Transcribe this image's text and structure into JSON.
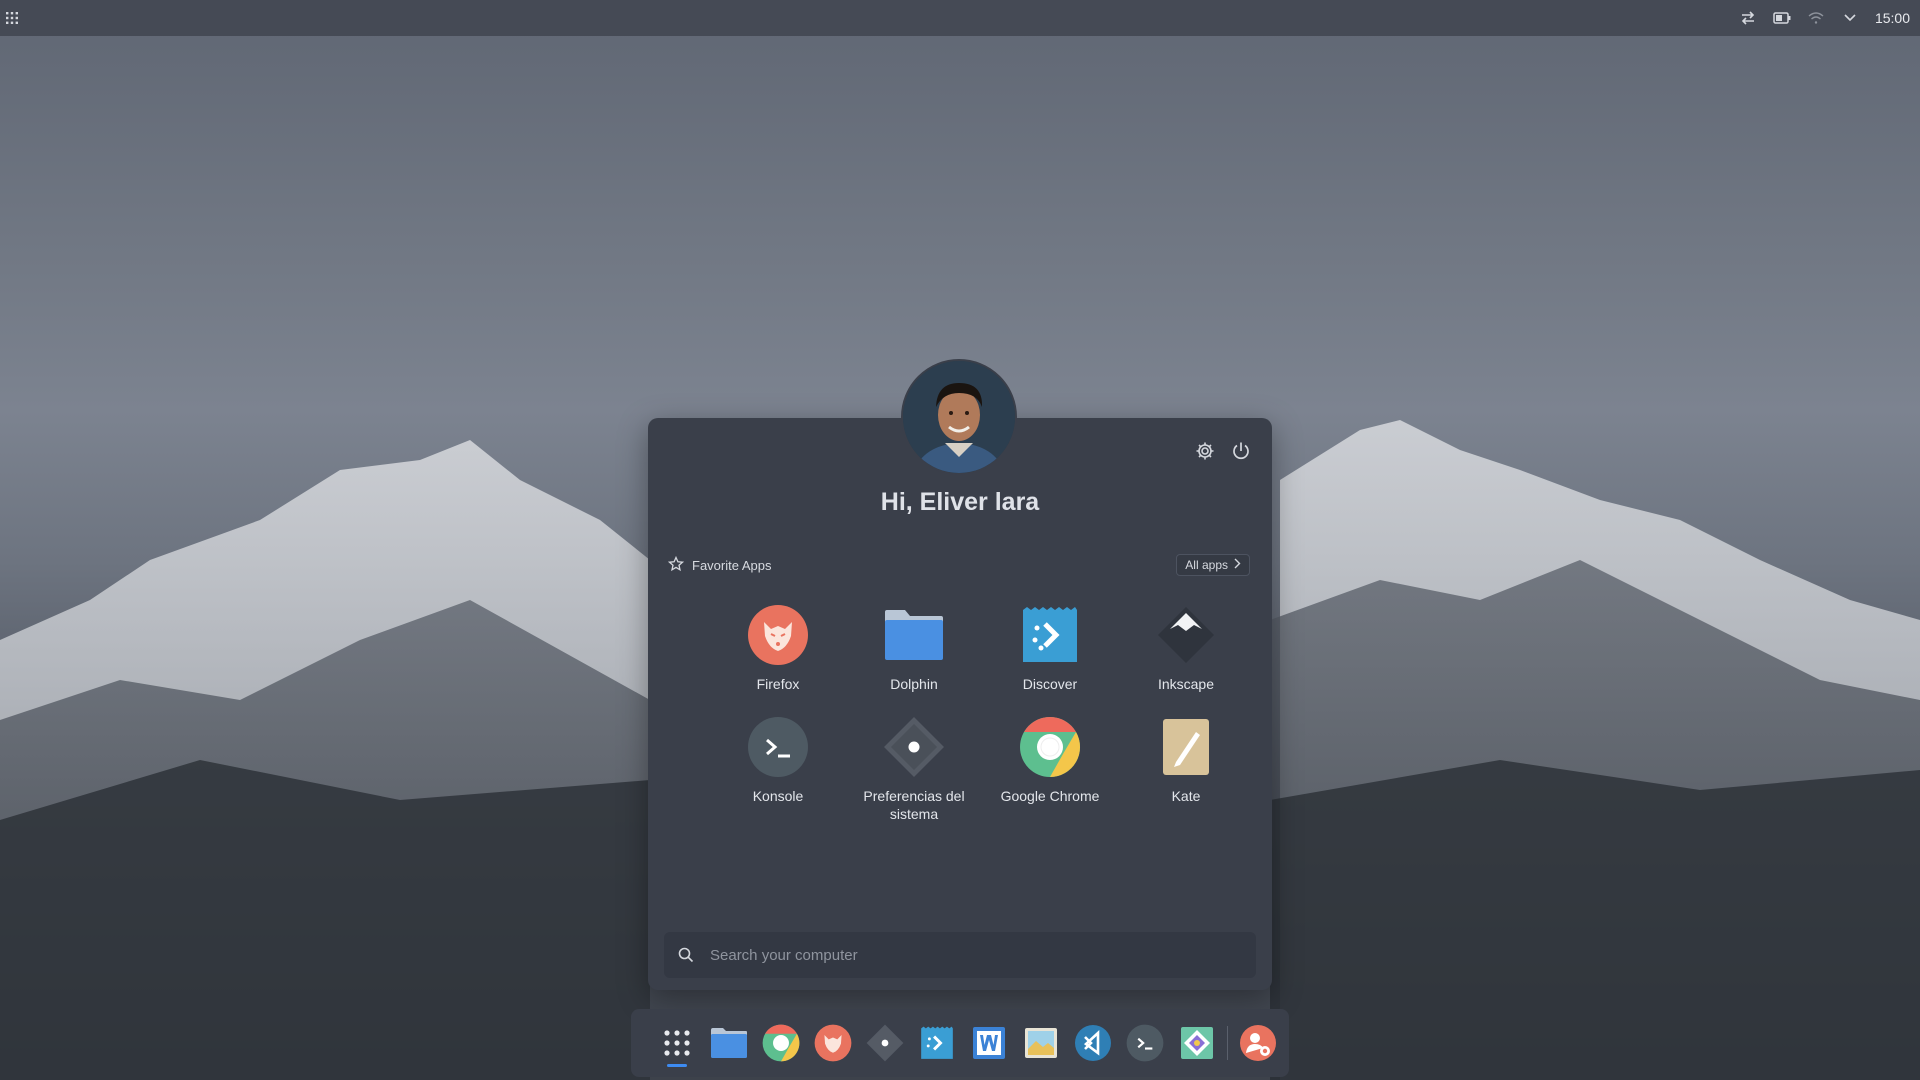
{
  "top_panel": {
    "launcher_icon": "app-grid-icon",
    "tray": [
      "transfer-icon",
      "battery-icon",
      "wifi-icon",
      "chevron-down-icon"
    ],
    "clock": "15:00"
  },
  "menu": {
    "greeting": "Hi, Eliver lara",
    "settings_icon": "gear-icon",
    "power_icon": "power-icon",
    "favorites_label": "Favorite Apps",
    "all_apps_label": "All apps",
    "apps": [
      {
        "label": "Firefox",
        "icon": "firefox-icon"
      },
      {
        "label": "Dolphin",
        "icon": "folder-icon"
      },
      {
        "label": "Discover",
        "icon": "discover-icon"
      },
      {
        "label": "Inkscape",
        "icon": "inkscape-icon"
      },
      {
        "label": "Konsole",
        "icon": "terminal-icon"
      },
      {
        "label": "Preferencias del sistema",
        "icon": "system-settings-icon"
      },
      {
        "label": "Google Chrome",
        "icon": "chrome-icon"
      },
      {
        "label": "Kate",
        "icon": "kate-icon"
      }
    ],
    "search_placeholder": "Search your computer"
  },
  "dock": {
    "items": [
      "app-grid-icon",
      "folder-icon",
      "chrome-icon",
      "firefox-icon",
      "system-settings-icon",
      "discover-icon",
      "writer-icon",
      "image-viewer-icon",
      "vscode-icon",
      "terminal-icon",
      "kde-store-icon",
      "user-switch-icon"
    ]
  },
  "colors": {
    "accent": "#3d8bf2",
    "panel": "#454a55",
    "menu_bg": "#3a3f4a",
    "firefox": "#e9735f",
    "folder": "#4a90e2"
  }
}
